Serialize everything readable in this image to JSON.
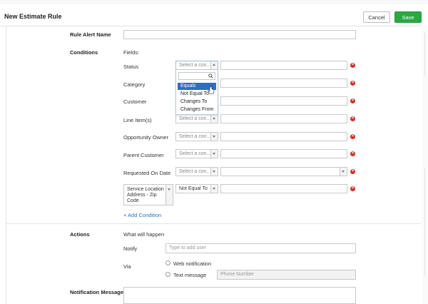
{
  "header": {
    "title": "New Estimate Rule",
    "cancel_label": "Cancel",
    "save_label": "Save"
  },
  "rule_alert_name": {
    "label": "Rule Alert Name",
    "value": ""
  },
  "conditions": {
    "label": "Conditions",
    "fields_label": "Fields:",
    "select_placeholder": "Select a con...",
    "rows": [
      {
        "field": "Status"
      },
      {
        "field": "Category"
      },
      {
        "field": "Customer"
      },
      {
        "field": "Line Item(s)"
      },
      {
        "field": "Opportunity Owner"
      },
      {
        "field": "Parent Customer"
      },
      {
        "field": "Requested On Date"
      }
    ],
    "custom_row": {
      "field_lines": [
        "Service Location",
        "Address - Zip",
        "Code"
      ],
      "operator": "Not Equal To"
    },
    "add_condition": "+ Add Condition",
    "dropdown_options": [
      "Equals",
      "Not Equal To",
      "Changes To",
      "Changes From"
    ],
    "dropdown_selected": "Equals"
  },
  "actions": {
    "label": "Actions",
    "what_label": "What will happen",
    "notify_label": "Notify",
    "notify_placeholder": "Type to add user",
    "via_label": "Via",
    "web_notification": "Web notification",
    "text_message": "Text message",
    "phone_placeholder": "Phone Number"
  },
  "notification_message": {
    "label": "Notification Message"
  },
  "colors": {
    "save_green": "#2aa844",
    "link_blue": "#2b74c7",
    "remove_red": "#d62a2a",
    "highlight_blue": "#2f6cc9"
  }
}
